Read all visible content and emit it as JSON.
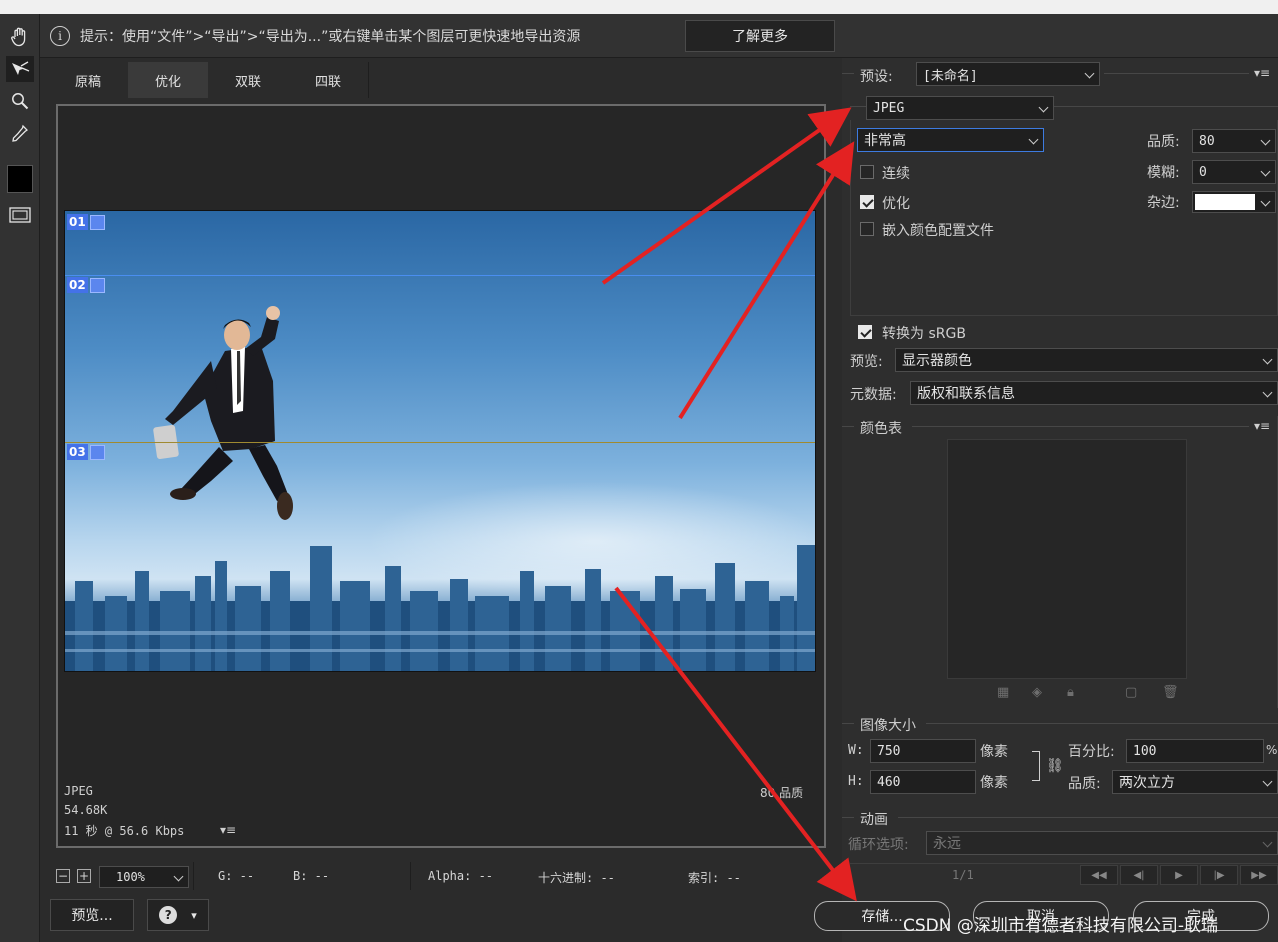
{
  "hint": {
    "text": "提示：使用“文件”>“导出”>“导出为...”或右键单击某个图层可更快速地导出资源",
    "learn_more": "了解更多"
  },
  "tabs": [
    "原稿",
    "优化",
    "双联",
    "四联"
  ],
  "slices": [
    "01",
    "02",
    "03"
  ],
  "image_info": {
    "format": "JPEG",
    "size": "54.68K",
    "time": "11 秒 @ 56.6 Kbps",
    "quality": "80 品质"
  },
  "status": {
    "zoom": "100%",
    "g": "G: --",
    "b": "B: --",
    "alpha": "Alpha: --",
    "hex": "十六进制: --",
    "index": "索引: --"
  },
  "bottom_buttons": {
    "preview": "预览...",
    "save": "存储...",
    "cancel": "取消",
    "done": "完成"
  },
  "settings": {
    "preset_label": "预设:",
    "preset_value": "[未命名]",
    "format_value": "JPEG",
    "quality_level": "非常高",
    "quality_label": "品质:",
    "quality_value": "80",
    "blur_label": "模糊:",
    "blur_value": "0",
    "matte_label": "杂边:",
    "matte_color": "#ffffff",
    "progressive_label": "连续",
    "progressive_checked": false,
    "optimized_label": "优化",
    "optimized_checked": true,
    "embed_profile_label": "嵌入颜色配置文件",
    "embed_profile_checked": false,
    "convert_srgb_label": "转换为 sRGB",
    "convert_srgb_checked": true,
    "preview_label": "预览:",
    "preview_value": "显示器颜色",
    "metadata_label": "元数据:",
    "metadata_value": "版权和联系信息"
  },
  "color_table": {
    "title": "颜色表"
  },
  "image_size": {
    "title": "图像大小",
    "w_label": "W:",
    "w_value": "750",
    "h_label": "H:",
    "h_value": "460",
    "unit": "像素",
    "percent_label": "百分比:",
    "percent_value": "100",
    "percent_unit": "%",
    "quality_label": "品质:",
    "quality_value": "两次立方"
  },
  "animation": {
    "title": "动画",
    "loop_label": "循环选项:",
    "loop_value": "永远",
    "frame_counter": "1/1"
  },
  "watermark": "CSDN @深圳市有德者科技有限公司-耿瑞",
  "colors": {
    "arrow": "#e32222",
    "slice_label": "#4472e8",
    "accent_border": "#3d7be0"
  }
}
